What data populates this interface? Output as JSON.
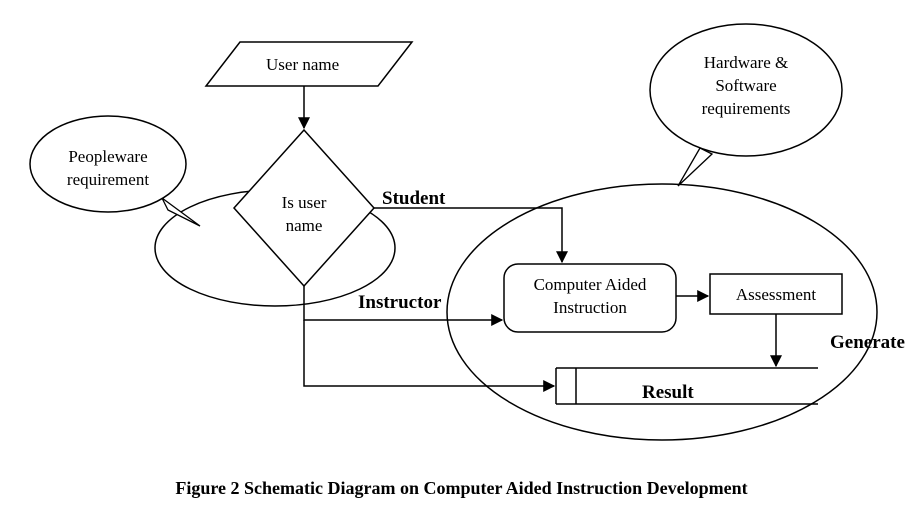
{
  "caption": "Figure 2 Schematic Diagram on Computer Aided Instruction Development",
  "nodes": {
    "username": "User name",
    "decision": "Is user\nname",
    "cai": "Computer Aided\nInstruction",
    "assessment": "Assessment",
    "result": "Result"
  },
  "callouts": {
    "peopleware": "Peopleware\nrequirement",
    "hwsoft": "Hardware &\nSoftware\nrequirements"
  },
  "edges": {
    "student": "Student",
    "instructor": "Instructor",
    "generate": "Generate"
  }
}
